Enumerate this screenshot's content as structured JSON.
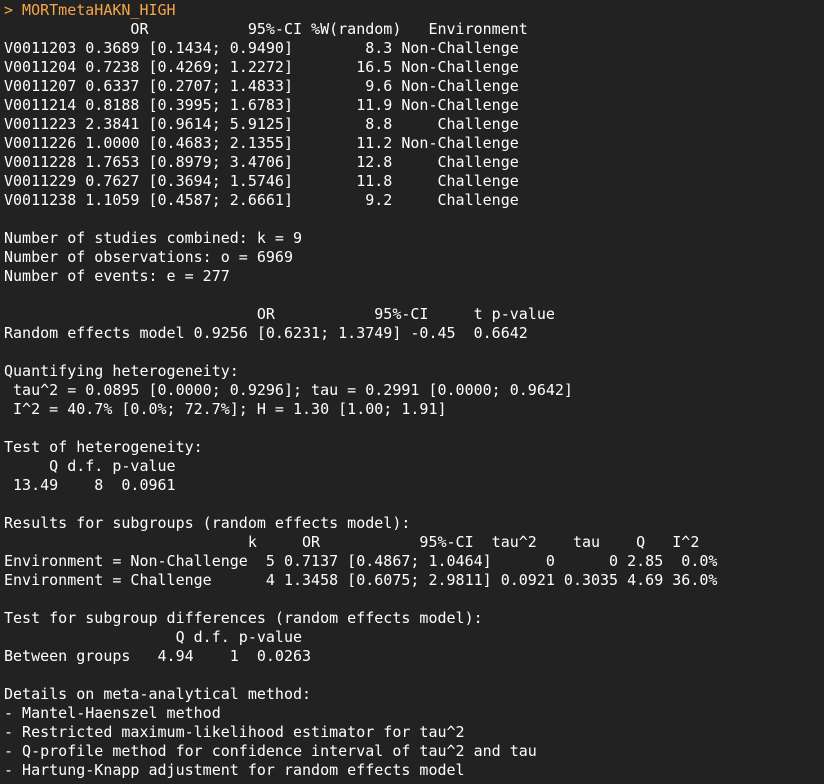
{
  "colors": {
    "background": "#222222",
    "prompt_text": "#f5a54a",
    "output_text": "#ffffff"
  },
  "console": {
    "command": "> MORTmetaHAKN_HIGH",
    "study_table": {
      "header": "              OR           95%-CI %W(random)   Environment",
      "rows": [
        "V0011203 0.3689 [0.1434; 0.9490]        8.3 Non-Challenge",
        "V0011204 0.7238 [0.4269; 1.2272]       16.5 Non-Challenge",
        "V0011207 0.6337 [0.2707; 1.4833]        9.6 Non-Challenge",
        "V0011214 0.8188 [0.3995; 1.6783]       11.9 Non-Challenge",
        "V0011223 2.3841 [0.9614; 5.9125]        8.8     Challenge",
        "V0011226 1.0000 [0.4683; 2.1355]       11.2 Non-Challenge",
        "V0011228 1.7653 [0.8979; 3.4706]       12.8     Challenge",
        "V0011229 0.7627 [0.3694; 1.5746]       11.8     Challenge",
        "V0011238 1.1059 [0.4587; 2.6661]        9.2     Challenge"
      ]
    },
    "counts": [
      "Number of studies combined: k = 9",
      "Number of observations: o = 6969",
      "Number of events: e = 277"
    ],
    "random_effects": {
      "header": "                            OR           95%-CI     t p-value",
      "row": "Random effects model 0.9256 [0.6231; 1.3749] -0.45  0.6642"
    },
    "heterogeneity_quant": {
      "title": "Quantifying heterogeneity:",
      "lines": [
        " tau^2 = 0.0895 [0.0000; 0.9296]; tau = 0.2991 [0.0000; 0.9642]",
        " I^2 = 40.7% [0.0%; 72.7%]; H = 1.30 [1.00; 1.91]"
      ]
    },
    "heterogeneity_test": {
      "title": "Test of heterogeneity:",
      "header": "     Q d.f. p-value",
      "row": " 13.49    8  0.0961"
    },
    "subgroups": {
      "title": "Results for subgroups (random effects model):",
      "header": "                           k     OR           95%-CI  tau^2    tau    Q   I^2",
      "rows": [
        "Environment = Non-Challenge  5 0.7137 [0.4867; 1.0464]      0      0 2.85  0.0%",
        "Environment = Challenge      4 1.3458 [0.6075; 2.9811] 0.0921 0.3035 4.69 36.0%"
      ]
    },
    "subgroup_diff": {
      "title": "Test for subgroup differences (random effects model):",
      "header": "                   Q d.f. p-value",
      "row": "Between groups   4.94    1  0.0263"
    },
    "details": {
      "title": "Details on meta-analytical method:",
      "items": [
        "- Mantel-Haenszel method",
        "- Restricted maximum-likelihood estimator for tau^2",
        "- Q-profile method for confidence interval of tau^2 and tau",
        "- Hartung-Knapp adjustment for random effects model"
      ]
    }
  }
}
